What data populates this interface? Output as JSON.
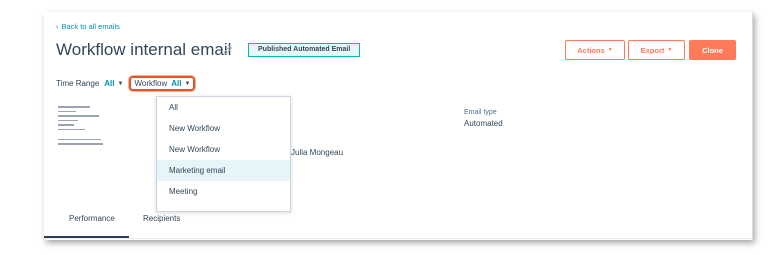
{
  "nav": {
    "back_label": "Back to all emails"
  },
  "email": {
    "title": "Workflow internal email",
    "status_badge": "Published Automated Email",
    "type_label": "Email type",
    "type_value": "Automated",
    "sender": "Julia Mongeau"
  },
  "actions": {
    "actions_label": "Actions",
    "export_label": "Export",
    "clone_label": "Clone"
  },
  "filters": {
    "time_range_label": "Time Range",
    "time_range_value": "All",
    "workflow_label": "Workflow",
    "workflow_value": "All"
  },
  "workflow_dropdown": {
    "options": [
      "All",
      "New Workflow",
      "New Workflow",
      "Marketing email",
      "Meeting"
    ],
    "highlighted_index": 3
  },
  "tabs": [
    "Performance",
    "Recipients"
  ],
  "colors": {
    "accent": "#ff7a59",
    "link": "#0091ae",
    "badge_border": "#00bda5",
    "highlight_border": "#e0562b"
  },
  "icons": [
    "chevron-left-icon",
    "pencil-icon",
    "caret-down-icon"
  ]
}
